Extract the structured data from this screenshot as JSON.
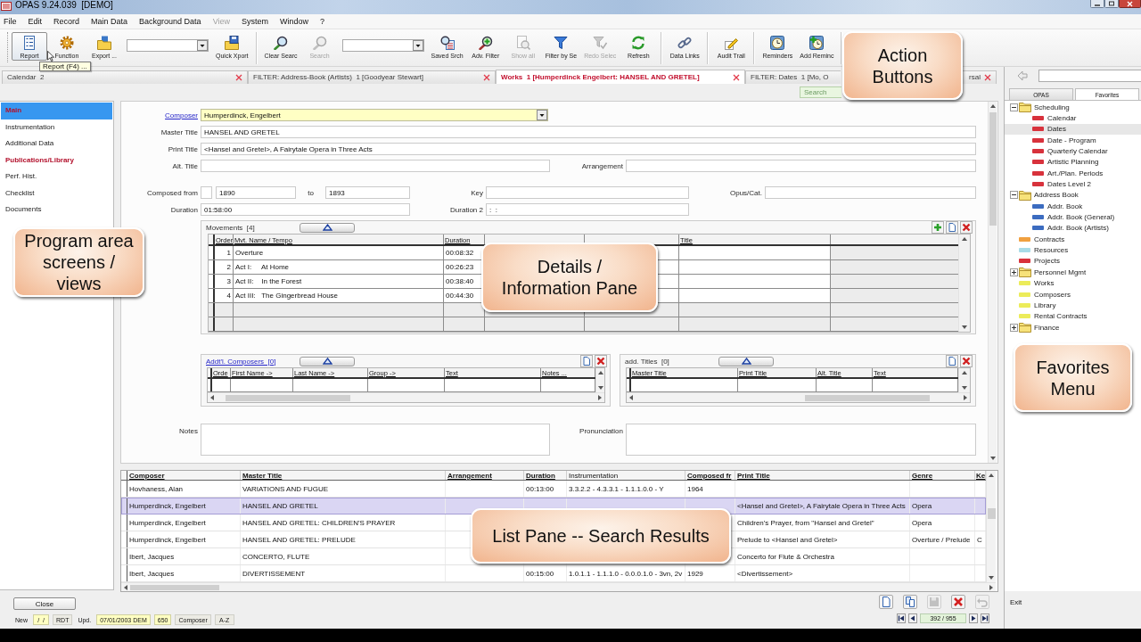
{
  "window": {
    "title": "OPAS 9.24.039  [DEMO]"
  },
  "menu": [
    {
      "label": "File",
      "disabled": false
    },
    {
      "label": "Edit",
      "disabled": false
    },
    {
      "label": "Record",
      "disabled": false
    },
    {
      "label": "Main Data",
      "disabled": false
    },
    {
      "label": "Background Data",
      "disabled": false
    },
    {
      "label": "View",
      "disabled": true
    },
    {
      "label": "System",
      "disabled": false
    },
    {
      "label": "Window",
      "disabled": false
    },
    {
      "label": "?",
      "disabled": false
    }
  ],
  "toolbar": {
    "groups": [
      [
        {
          "kind": "button",
          "label": "Report",
          "pressed": true,
          "disabled": false
        },
        {
          "kind": "button",
          "label": "Function",
          "pressed": false,
          "disabled": false
        },
        {
          "kind": "button",
          "label": "Export ...",
          "pressed": false,
          "disabled": false
        },
        {
          "kind": "combo"
        },
        {
          "kind": "button",
          "label": "Quick Xport",
          "pressed": false,
          "disabled": false
        }
      ],
      [
        {
          "kind": "button",
          "label": "Clear Searc",
          "pressed": false,
          "disabled": false
        },
        {
          "kind": "button",
          "label": "Search",
          "pressed": false,
          "disabled": true
        },
        {
          "kind": "combo"
        },
        {
          "kind": "button",
          "label": "Saved Srch",
          "pressed": false,
          "disabled": false
        },
        {
          "kind": "button",
          "label": "Adv. Filter",
          "pressed": false,
          "disabled": false
        },
        {
          "kind": "button",
          "label": "Show all",
          "pressed": false,
          "disabled": true
        },
        {
          "kind": "button",
          "label": "Filter by Se",
          "pressed": false,
          "disabled": false
        },
        {
          "kind": "button",
          "label": "Redo Selec",
          "pressed": false,
          "disabled": true
        },
        {
          "kind": "button",
          "label": "Refresh",
          "pressed": false,
          "disabled": false
        }
      ],
      [
        {
          "kind": "button",
          "label": "Data Links",
          "pressed": false,
          "disabled": false
        }
      ],
      [
        {
          "kind": "button",
          "label": "Audit Trail",
          "pressed": false,
          "disabled": false
        }
      ],
      [
        {
          "kind": "button",
          "label": "Reminders",
          "pressed": false,
          "disabled": false
        },
        {
          "kind": "button",
          "label": "Add Reminc",
          "pressed": false,
          "disabled": false
        }
      ]
    ],
    "tooltip": "Report (F4) ..."
  },
  "tabs": [
    {
      "label": "Calendar  2",
      "selected": false
    },
    {
      "label": "FILTER: Address-Book (Artists)  1 [Goodyear Stewart]",
      "selected": false
    },
    {
      "label": "Works  1 [Humperdinck Engelbert: HANSEL AND GRETEL]",
      "selected": true
    },
    {
      "label": "FILTER: Dates  1 [Mo, O",
      "label_end": "rsal",
      "selected": false
    }
  ],
  "quick_search": {
    "placeholder": "Search"
  },
  "sidebar": {
    "items": [
      {
        "label": "Main",
        "selected": true,
        "highlighted": true
      },
      {
        "label": "Instrumentation",
        "selected": false,
        "highlighted": false
      },
      {
        "label": "Additional Data",
        "selected": false,
        "highlighted": false
      },
      {
        "label": "Publications/Library",
        "selected": false,
        "highlighted": true
      },
      {
        "label": "Perf. Hist.",
        "selected": false,
        "highlighted": false
      },
      {
        "label": "Checklist",
        "selected": false,
        "highlighted": false
      },
      {
        "label": "Documents",
        "selected": false,
        "highlighted": false
      }
    ]
  },
  "form": {
    "composer": {
      "label": "Composer",
      "value": "Humperdinck, Engelbert"
    },
    "master_title": {
      "label": "Master Title",
      "value": "HANSEL AND GRETEL"
    },
    "print_title": {
      "label": "Print Title",
      "value": "<Hansel and Gretel>, A Fairytale Opera in Three Acts"
    },
    "alt_title": {
      "label": "Alt. Title"
    },
    "arrangement": {
      "label": "Arrangement"
    },
    "composed": {
      "label": "Composed from",
      "from": "1890",
      "to_label": "to",
      "to": "1893"
    },
    "key": {
      "label": "Key"
    },
    "opus": {
      "label": "Opus/Cat."
    },
    "duration": {
      "label": "Duration",
      "value": "01:58:00"
    },
    "duration_2": {
      "label": "Duration 2",
      "value": ":  :"
    },
    "movements": {
      "title": "Movements  [4]",
      "link": false,
      "columns": [
        "Order",
        "Mvt. Name / Tempo",
        "Duration",
        null,
        null,
        "Title",
        null
      ],
      "rows": [
        {
          "order": "1",
          "name": "Overture",
          "duration": "00:08:32"
        },
        {
          "order": "2",
          "name": "Act I:     At Home",
          "duration": "00:26:23"
        },
        {
          "order": "3",
          "name": "Act II:    In the Forest",
          "duration": "00:38:40"
        },
        {
          "order": "4",
          "name": "Act III:   The Gingerbread House",
          "duration": "00:44:30"
        }
      ]
    },
    "additional_composers": {
      "title": "Addt'l. Composers  [0]",
      "link": true,
      "columns": [
        "Orde",
        "First Name ->",
        "Last Name ->",
        "Group ->",
        "Text",
        "Notes ..."
      ]
    },
    "additional_titles": {
      "title": "add. Titles  [0]",
      "link": false,
      "columns": [
        "Master Title",
        "Print Title",
        "Alt. Title",
        "Text"
      ]
    },
    "notes": {
      "label": "Notes"
    },
    "pronunciation": {
      "label": "Pronunciation"
    }
  },
  "list": {
    "columns": [
      {
        "label": "Composer",
        "sortable": true
      },
      {
        "label": "Master Title",
        "sortable": true
      },
      {
        "label": "Arrangement",
        "sortable": true
      },
      {
        "label": "Duration",
        "sortable": true
      },
      {
        "label": "Instrumentation",
        "sortable": false
      },
      {
        "label": "Composed fr",
        "sortable": true
      },
      {
        "label": "Print Title",
        "sortable": true
      },
      {
        "label": "Genre",
        "sortable": true
      },
      {
        "label": "Ke",
        "sortable": true
      }
    ],
    "rows": [
      {
        "selected": false,
        "cells": [
          "Hovhaness, Alan",
          "VARIATIONS AND FUGUE",
          null,
          "00:13:00",
          "3.3.2.2 - 4.3.3.1 - 1.1.1.0.0 - Y",
          "1964",
          null,
          null,
          null
        ]
      },
      {
        "selected": true,
        "cells": [
          "Humperdinck, Engelbert",
          "HANSEL AND GRETEL",
          null,
          null,
          null,
          null,
          "<Hansel and Gretel>, A Fairytale Opera in Three Acts",
          "Opera",
          null
        ]
      },
      {
        "selected": false,
        "cells": [
          "Humperdinck, Engelbert",
          "HANSEL AND GRETEL: CHILDREN'S PRAYER",
          null,
          null,
          null,
          null,
          "Children's Prayer, from \"Hansel and Gretel\"",
          "Opera",
          null
        ]
      },
      {
        "selected": false,
        "cells": [
          "Humperdinck, Engelbert",
          "HANSEL AND GRETEL: PRELUDE",
          null,
          null,
          null,
          null,
          "Prelude to <Hansel and Gretel>",
          "Overture / Prelude",
          "C"
        ]
      },
      {
        "selected": false,
        "cells": [
          "Ibert, Jacques",
          "CONCERTO, FLUTE",
          null,
          null,
          null,
          null,
          "Concerto for Flute & Orchestra",
          null,
          null
        ]
      },
      {
        "selected": false,
        "cells": [
          "Ibert, Jacques",
          "DIVERTISSEMENT",
          null,
          "00:15:00",
          "1.0.1.1 - 1.1.1.0 - 0.0.0.1.0 - 3vn, 2v",
          "1929",
          "<Divertissement>",
          null,
          null
        ]
      }
    ]
  },
  "footer": {
    "close": "Close",
    "status": [
      {
        "kind": "label",
        "text": "New"
      },
      {
        "kind": "field",
        "text": "/  /"
      },
      {
        "kind": "cell",
        "text": "RDT"
      },
      {
        "kind": "label",
        "text": "Upd."
      },
      {
        "kind": "field",
        "text": "07/01/2003 DEM"
      },
      {
        "kind": "field",
        "text": "650"
      },
      {
        "kind": "cell",
        "text": "Composer"
      },
      {
        "kind": "cell",
        "text": "A-Z"
      }
    ],
    "record_actions": [
      {
        "disabled": false
      },
      {
        "disabled": false
      },
      {
        "disabled": true
      },
      {
        "disabled": false
      },
      {
        "disabled": true
      }
    ],
    "counter": "392 / 955"
  },
  "favorites": {
    "tabs": [
      {
        "label": "OPAS",
        "selected": false
      },
      {
        "label": "Favorites",
        "selected": true
      }
    ],
    "tree": [
      {
        "kind": "folder",
        "label": "Scheduling",
        "expanded": true,
        "selected": false,
        "children": [
          {
            "kind": "item",
            "label": "Calendar",
            "color": "#d8323c",
            "selected": false
          },
          {
            "kind": "item",
            "label": "Dates",
            "color": "#d8323c",
            "selected": true
          },
          {
            "kind": "item",
            "label": "Date - Program",
            "color": "#d8323c",
            "selected": false
          },
          {
            "kind": "item",
            "label": "Quarterly Calendar",
            "color": "#d8323c",
            "selected": false
          },
          {
            "kind": "item",
            "label": "Artistic Planning",
            "color": "#d8323c",
            "selected": false
          },
          {
            "kind": "item",
            "label": "Art./Plan. Periods",
            "color": "#d8323c",
            "selected": false
          },
          {
            "kind": "item",
            "label": "Dates Level 2",
            "color": "#d8323c",
            "selected": false
          }
        ]
      },
      {
        "kind": "folder",
        "label": "Address Book",
        "expanded": true,
        "selected": false,
        "children": [
          {
            "kind": "item",
            "label": "Addr. Book",
            "color": "#3c6cc0",
            "selected": false
          },
          {
            "kind": "item",
            "label": "Addr. Book (General)",
            "color": "#3c6cc0",
            "selected": false
          },
          {
            "kind": "item",
            "label": "Addr. Book (Artists)",
            "color": "#3c6cc0",
            "selected": false
          }
        ]
      },
      {
        "kind": "item",
        "label": "Contracts",
        "color": "#f0a040",
        "selected": false
      },
      {
        "kind": "item",
        "label": "Resources",
        "color": "#a8dce8",
        "selected": false
      },
      {
        "kind": "item",
        "label": "Projects",
        "color": "#d8323c",
        "selected": false
      },
      {
        "kind": "folder",
        "label": "Personnel Mgmt",
        "expanded": false,
        "selected": false
      },
      {
        "kind": "item",
        "label": "Works",
        "color": "#ecec5a",
        "selected": false
      },
      {
        "kind": "item",
        "label": "Composers",
        "color": "#ecec5a",
        "selected": false
      },
      {
        "kind": "item",
        "label": "Library",
        "color": "#ecec5a",
        "selected": false
      },
      {
        "kind": "item",
        "label": "Rental Contracts",
        "color": "#ecec5a",
        "selected": false
      },
      {
        "kind": "folder",
        "label": "Finance",
        "expanded": false,
        "selected": false
      }
    ],
    "exit": "Exit"
  },
  "callouts": [
    "Action\nButtons",
    "Program area\nscreens /\nviews",
    "Details /\nInformation Pane",
    "Favorites\nMenu",
    "List Pane -- Search Results"
  ]
}
